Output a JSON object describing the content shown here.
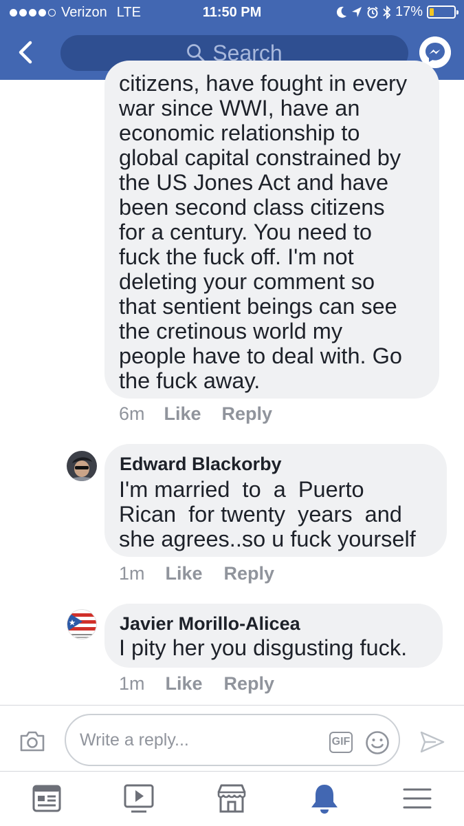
{
  "status_bar": {
    "carrier": "Verizon",
    "network": "LTE",
    "time": "11:50 PM",
    "battery": "17%",
    "battery_level": 0.17,
    "battery_color": "#f3c623"
  },
  "header": {
    "search_placeholder": "Search",
    "color": "#4267b2",
    "icons": [
      "back-icon",
      "search-icon",
      "messenger-icon"
    ]
  },
  "comments": [
    {
      "author": "",
      "text_lines": [
        "citizens, have fought in every",
        "war since WWI, have an",
        "economic relationship to",
        "global capital constrained by",
        "the US Jones Act and have",
        "been second class citizens",
        "for a century. You need to",
        "fuck the fuck off. I'm not",
        "deleting your comment so",
        "that sentient beings can see",
        "the cretinous world my",
        "people have to deal with. Go",
        "the fuck away."
      ],
      "time": "6m",
      "like": "Like",
      "reply": "Reply"
    },
    {
      "author": "Edward Blackorby",
      "text_lines": [
        "I'm married  to  a  Puerto",
        "Rican  for twenty  years  and",
        "she agrees..so u fuck yourself"
      ],
      "time": "1m",
      "like": "Like",
      "reply": "Reply"
    },
    {
      "author": "Javier Morillo-Alicea",
      "text_lines": [
        "I pity her you disgusting fuck."
      ],
      "time": "1m",
      "like": "Like",
      "reply": "Reply"
    }
  ],
  "composer": {
    "placeholder": "Write a reply...",
    "gif_label": "GIF",
    "icons": [
      "camera-icon",
      "emoji-icon",
      "send-icon"
    ]
  },
  "bottom_nav": {
    "items": [
      "news-feed-icon",
      "video-icon",
      "marketplace-icon",
      "notifications-icon",
      "menu-icon"
    ],
    "active": "notifications-icon",
    "active_color": "#4267b2",
    "inactive_color": "#6d7078"
  }
}
